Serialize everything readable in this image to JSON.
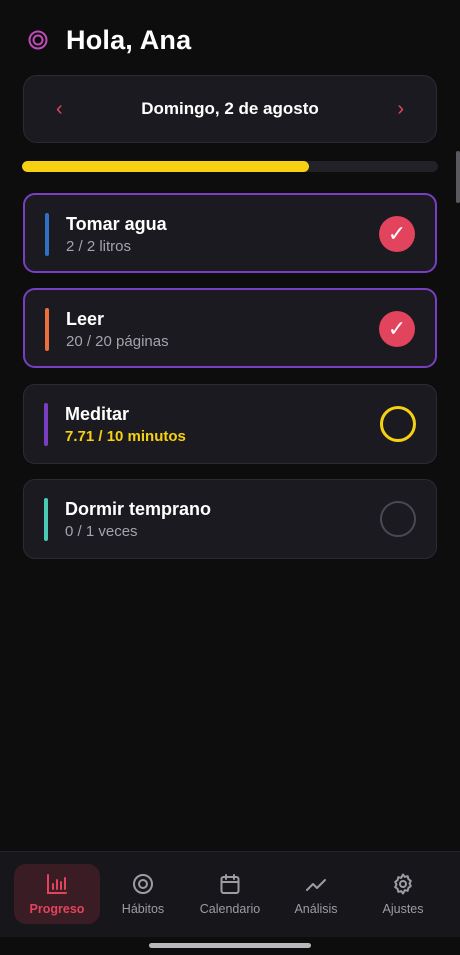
{
  "header": {
    "greeting": "Hola, Ana"
  },
  "date_selector": {
    "date": "Domingo, 2 de agosto",
    "prev": "‹",
    "next": "›"
  },
  "progress": {
    "fraction": 0.69,
    "color": "#f6d112"
  },
  "habits": [
    {
      "title": "Tomar agua",
      "subtitle": "2 / 2 litros",
      "color": "#2f6fc6",
      "status": "done"
    },
    {
      "title": "Leer",
      "subtitle": "20 / 20 páginas",
      "color": "#ec6e3c",
      "status": "done"
    },
    {
      "title": "Meditar",
      "subtitle": "7.71 / 10 minutos",
      "color": "#7a3ec2",
      "status": "partial"
    },
    {
      "title": "Dormir temprano",
      "subtitle": "0 / 1 veces",
      "color": "#4bc9b4",
      "status": "empty"
    }
  ],
  "check_glyph": "✓",
  "nav": [
    {
      "label": "Progreso",
      "icon": "bar-chart-icon",
      "active": true
    },
    {
      "label": "Hábitos",
      "icon": "target-icon",
      "active": false
    },
    {
      "label": "Calendario",
      "icon": "calendar-icon",
      "active": false
    },
    {
      "label": "Análisis",
      "icon": "trend-icon",
      "active": false
    },
    {
      "label": "Ajustes",
      "icon": "gear-icon",
      "active": false
    }
  ],
  "colors": {
    "accent": "#e2435d",
    "purple": "#7a3ec2",
    "yellow": "#f6d112"
  }
}
